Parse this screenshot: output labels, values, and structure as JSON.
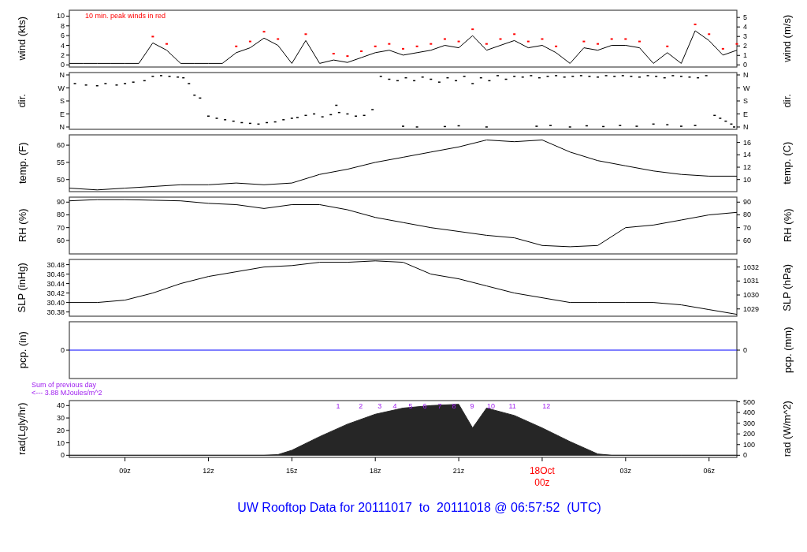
{
  "panels": [
    {
      "left_label": "wind (kts)",
      "note": "10 min. peak winds in red",
      "chart_data": {
        "type": "line",
        "xlim": [
          "2011-10-17T07:00Z",
          "2011-10-18T07:00Z"
        ],
        "ylim": [
          -0.44,
          11.2
        ],
        "yticks": [
          0,
          2,
          4,
          6,
          8,
          10
        ],
        "x": [
          "2011-10-17T07:00Z",
          "2011-10-17T07:30Z",
          "2011-10-17T08:00Z",
          "2011-10-17T08:30Z",
          "2011-10-17T09:00Z",
          "2011-10-17T09:30Z",
          "2011-10-17T10:00Z",
          "2011-10-17T10:30Z",
          "2011-10-17T11:00Z",
          "2011-10-17T11:30Z",
          "2011-10-17T12:00Z",
          "2011-10-17T12:30Z",
          "2011-10-17T13:00Z",
          "2011-10-17T13:30Z",
          "2011-10-17T14:00Z",
          "2011-10-17T14:30Z",
          "2011-10-17T15:00Z",
          "2011-10-17T15:30Z",
          "2011-10-17T16:00Z",
          "2011-10-17T16:30Z",
          "2011-10-17T17:00Z",
          "2011-10-17T17:30Z",
          "2011-10-17T18:00Z",
          "2011-10-17T18:30Z",
          "2011-10-17T19:00Z",
          "2011-10-17T19:30Z",
          "2011-10-17T20:00Z",
          "2011-10-17T20:30Z",
          "2011-10-17T21:00Z",
          "2011-10-17T21:30Z",
          "2011-10-17T22:00Z",
          "2011-10-17T22:30Z",
          "2011-10-17T23:00Z",
          "2011-10-17T23:30Z",
          "2011-10-18T00:00Z",
          "2011-10-18T00:30Z",
          "2011-10-18T01:00Z",
          "2011-10-18T01:30Z",
          "2011-10-18T02:00Z",
          "2011-10-18T02:30Z",
          "2011-10-18T03:00Z",
          "2011-10-18T03:30Z",
          "2011-10-18T04:00Z",
          "2011-10-18T04:30Z",
          "2011-10-18T05:00Z",
          "2011-10-18T05:30Z",
          "2011-10-18T06:00Z",
          "2011-10-18T06:30Z",
          "2011-10-18T07:00Z"
        ],
        "series": [
          {
            "color": "#000000",
            "values": [
              0.3,
              0.3,
              0.3,
              0.3,
              0.3,
              0.3,
              4.5,
              3,
              0.3,
              0.3,
              0.3,
              0.3,
              2.5,
              3.5,
              5.5,
              4,
              0.3,
              5,
              0.3,
              1,
              0.5,
              1.5,
              2.5,
              3,
              2,
              2.5,
              3,
              4,
              3.5,
              6,
              3,
              4,
              5,
              3.5,
              4,
              2.5,
              0.3,
              3.5,
              3,
              4,
              4,
              3.5,
              0.3,
              2.5,
              0.3,
              7,
              5,
              2,
              3
            ]
          },
          {
            "type": "scatter",
            "color": "#ff0000",
            "values": [
              null,
              null,
              null,
              null,
              null,
              null,
              5.8,
              4.3,
              null,
              null,
              null,
              null,
              3.8,
              4.8,
              6.8,
              5.3,
              null,
              6.3,
              null,
              2.3,
              1.8,
              2.8,
              3.8,
              4.3,
              3.3,
              3.8,
              4.3,
              5.3,
              4.8,
              7.3,
              4.3,
              5.3,
              6.3,
              4.8,
              5.3,
              3.8,
              null,
              4.8,
              4.3,
              5.3,
              5.3,
              4.8,
              null,
              3.8,
              null,
              8.3,
              6.3,
              3.3,
              4.3
            ]
          }
        ]
      },
      "right_axis": {
        "label": "wind (m/s)",
        "kind": "ms",
        "ticks": [
          "5",
          "4",
          "3",
          "2",
          "1",
          "0"
        ]
      }
    },
    {
      "left_label": "dir.",
      "axis_ticks": [
        "N",
        "W",
        "S",
        "E",
        "N"
      ],
      "right_axis": {
        "label": "dir.",
        "ticks": [
          "N",
          "W",
          "S",
          "E",
          "N"
        ]
      }
    },
    {
      "left_label": "temp. (F)",
      "chart_data": {
        "type": "line",
        "xlim": [
          "2011-10-17T07:00Z",
          "2011-10-18T07:00Z"
        ],
        "ylim": [
          46.5,
          63
        ],
        "yticks": [
          50,
          55,
          60
        ],
        "x": [
          "2011-10-17T07:00Z",
          "2011-10-17T08:00Z",
          "2011-10-17T09:00Z",
          "2011-10-17T10:00Z",
          "2011-10-17T11:00Z",
          "2011-10-17T12:00Z",
          "2011-10-17T13:00Z",
          "2011-10-17T14:00Z",
          "2011-10-17T15:00Z",
          "2011-10-17T16:00Z",
          "2011-10-17T17:00Z",
          "2011-10-17T18:00Z",
          "2011-10-17T19:00Z",
          "2011-10-17T20:00Z",
          "2011-10-17T21:00Z",
          "2011-10-17T22:00Z",
          "2011-10-17T23:00Z",
          "2011-10-18T00:00Z",
          "2011-10-18T01:00Z",
          "2011-10-18T02:00Z",
          "2011-10-18T03:00Z",
          "2011-10-18T04:00Z",
          "2011-10-18T05:00Z",
          "2011-10-18T06:00Z",
          "2011-10-18T07:00Z"
        ],
        "series": [
          {
            "color": "#000000",
            "values": [
              47.5,
              47,
              47.5,
              48,
              48.5,
              48.5,
              49,
              48.5,
              49,
              51.5,
              53,
              55,
              56.5,
              58,
              59.5,
              61.5,
              61,
              61.5,
              58,
              55.5,
              54,
              52.5,
              51.5,
              51,
              51
            ]
          }
        ]
      },
      "right_axis": {
        "label": "temp. (C)",
        "kind": "celsius",
        "ticks": [
          "16",
          "14",
          "12",
          "10"
        ]
      }
    },
    {
      "left_label": "RH (%)",
      "chart_data": {
        "type": "line",
        "xlim": [
          "2011-10-17T07:00Z",
          "2011-10-18T07:00Z"
        ],
        "ylim": [
          49.4,
          93.9
        ],
        "yticks": [
          60,
          70,
          80,
          90
        ],
        "x": [
          "2011-10-17T07:00Z",
          "2011-10-17T08:00Z",
          "2011-10-17T09:00Z",
          "2011-10-17T10:00Z",
          "2011-10-17T11:00Z",
          "2011-10-17T12:00Z",
          "2011-10-17T13:00Z",
          "2011-10-17T14:00Z",
          "2011-10-17T15:00Z",
          "2011-10-17T16:00Z",
          "2011-10-17T17:00Z",
          "2011-10-17T18:00Z",
          "2011-10-17T19:00Z",
          "2011-10-17T20:00Z",
          "2011-10-17T21:00Z",
          "2011-10-17T22:00Z",
          "2011-10-17T23:00Z",
          "2011-10-18T00:00Z",
          "2011-10-18T01:00Z",
          "2011-10-18T02:00Z",
          "2011-10-18T03:00Z",
          "2011-10-18T04:00Z",
          "2011-10-18T05:00Z",
          "2011-10-18T06:00Z",
          "2011-10-18T07:00Z"
        ],
        "series": [
          {
            "color": "#000000",
            "values": [
              91,
              92,
              92,
              91.5,
              91,
              89,
              88,
              85,
              88,
              88,
              84,
              78,
              74,
              70,
              67,
              64,
              62,
              56,
              55,
              56,
              70,
              72,
              76,
              80,
              82
            ]
          }
        ]
      },
      "right_axis": {
        "label": "RH (%)",
        "kind": "same",
        "ticks": [
          "90",
          "80",
          "70",
          "60"
        ]
      }
    },
    {
      "left_label": "SLP (inHg)",
      "chart_data": {
        "type": "line",
        "xlim": [
          "2011-10-17T07:00Z",
          "2011-10-18T07:00Z"
        ],
        "ylim": [
          30.371,
          30.491
        ],
        "yticks": [
          {
            "value": 30.38,
            "label": "30.38"
          },
          {
            "value": 30.4,
            "label": "30.40"
          },
          {
            "value": 30.42,
            "label": "30.42"
          },
          {
            "value": 30.44,
            "label": "30.44"
          },
          {
            "value": 30.46,
            "label": "30.46"
          },
          {
            "value": 30.48,
            "label": "30.48"
          }
        ],
        "x": [
          "2011-10-17T07:00Z",
          "2011-10-17T08:00Z",
          "2011-10-17T09:00Z",
          "2011-10-17T10:00Z",
          "2011-10-17T11:00Z",
          "2011-10-17T12:00Z",
          "2011-10-17T13:00Z",
          "2011-10-17T14:00Z",
          "2011-10-17T15:00Z",
          "2011-10-17T16:00Z",
          "2011-10-17T17:00Z",
          "2011-10-17T18:00Z",
          "2011-10-17T19:00Z",
          "2011-10-17T20:00Z",
          "2011-10-17T21:00Z",
          "2011-10-17T22:00Z",
          "2011-10-17T23:00Z",
          "2011-10-18T00:00Z",
          "2011-10-18T01:00Z",
          "2011-10-18T02:00Z",
          "2011-10-18T03:00Z",
          "2011-10-18T04:00Z",
          "2011-10-18T05:00Z",
          "2011-10-18T06:00Z",
          "2011-10-18T07:00Z"
        ],
        "series": [
          {
            "color": "#000000",
            "values": [
              30.4,
              30.4,
              30.405,
              30.42,
              30.44,
              30.455,
              30.465,
              30.475,
              30.478,
              30.485,
              30.485,
              30.488,
              30.485,
              30.46,
              30.45,
              30.435,
              30.42,
              30.41,
              30.4,
              30.4,
              30.4,
              30.4,
              30.395,
              30.385,
              30.375
            ]
          }
        ]
      },
      "right_axis": {
        "label": "SLP (hPa)",
        "kind": "hpa",
        "ticks": [
          "1032",
          "1031",
          "1030",
          "1029"
        ]
      }
    },
    {
      "left_label": "pcp. (in)",
      "axis_ticks": [
        "0"
      ],
      "right_axis": {
        "label": "pcp. (mm)",
        "ticks": [
          "0"
        ]
      }
    },
    {
      "summary": [
        "Sum of previous day",
        "<--- 3.88 MJoules/m^2"
      ],
      "left_label": "rad(Lgly/hr)",
      "markers": [
        "1",
        "2",
        "3",
        "4",
        "5",
        "6",
        "7",
        "8",
        "9",
        "10",
        "11",
        "12"
      ],
      "chart_data": {
        "type": "area",
        "xlim": [
          "2011-10-17T07:00Z",
          "2011-10-18T07:00Z"
        ],
        "ylim": [
          -1.7,
          44
        ],
        "yticks": [
          0,
          10,
          20,
          30,
          40
        ],
        "xticks": [
          {
            "value": "2011-10-17T09:00Z",
            "label": "09z"
          },
          {
            "value": "2011-10-17T12:00Z",
            "label": "12z"
          },
          {
            "value": "2011-10-17T15:00Z",
            "label": "15z"
          },
          {
            "value": "2011-10-17T18:00Z",
            "label": "18z"
          },
          {
            "value": "2011-10-17T21:00Z",
            "label": "21z"
          },
          {
            "value": "2011-10-18T00:00Z",
            "label": "18Oct"
          },
          {
            "value": "2011-10-18T03:00Z",
            "label": "03z"
          },
          {
            "value": "2011-10-18T06:00Z",
            "label": "06z"
          }
        ],
        "x": [
          "2011-10-17T07:00Z",
          "2011-10-17T08:00Z",
          "2011-10-17T09:00Z",
          "2011-10-17T10:00Z",
          "2011-10-17T11:00Z",
          "2011-10-17T12:00Z",
          "2011-10-17T13:00Z",
          "2011-10-17T14:00Z",
          "2011-10-17T14:30Z",
          "2011-10-17T15:00Z",
          "2011-10-17T16:00Z",
          "2011-10-17T17:00Z",
          "2011-10-17T18:00Z",
          "2011-10-17T19:00Z",
          "2011-10-17T20:00Z",
          "2011-10-17T21:00Z",
          "2011-10-17T21:30Z",
          "2011-10-17T22:00Z",
          "2011-10-17T23:00Z",
          "2011-10-18T00:00Z",
          "2011-10-18T01:00Z",
          "2011-10-18T02:00Z",
          "2011-10-18T02:30Z",
          "2011-10-18T03:00Z",
          "2011-10-18T04:00Z",
          "2011-10-18T05:00Z",
          "2011-10-18T06:00Z",
          "2011-10-18T07:00Z"
        ],
        "series": [
          {
            "color": "#262626",
            "values": [
              0,
              0,
              0,
              0,
              0,
              0,
              0,
              0,
              0.5,
              4,
              15,
              25,
              33,
              38,
              40,
              41,
              22,
              38,
              32,
              22,
              11,
              1,
              0,
              0,
              0,
              0,
              0,
              0
            ]
          }
        ]
      },
      "right_axis": {
        "label": "rad (W/m^2)",
        "kind": "wm2",
        "ticks": [
          "500",
          "400",
          "300",
          "200",
          "100",
          "0"
        ]
      },
      "date_tick": {
        "hour": "00z"
      }
    }
  ],
  "title": "UW Rooftop Data for 20111017  to  20111018 @ 06:57:52  (UTC)"
}
